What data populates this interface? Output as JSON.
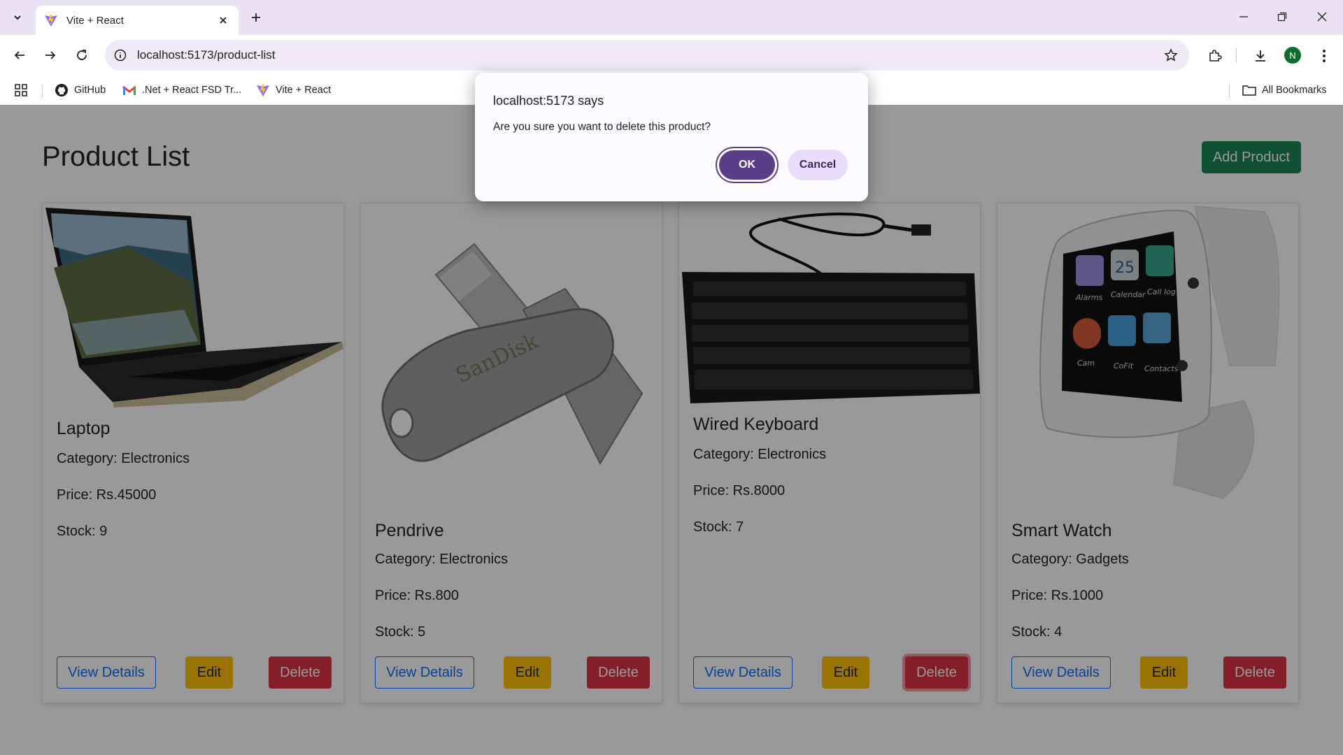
{
  "browser": {
    "tab_title": "Vite + React",
    "url": "localhost:5173/product-list",
    "avatar_letter": "N",
    "bookmarks": [
      {
        "label": "GitHub",
        "icon": "github-icon"
      },
      {
        "label": ".Net + React FSD Tr...",
        "icon": "gmail-icon"
      },
      {
        "label": "Vite + React",
        "icon": "vite-icon"
      }
    ],
    "all_bookmarks": "All Bookmarks"
  },
  "page": {
    "title": "Product List",
    "add_button": "Add Product"
  },
  "products": [
    {
      "name": "Laptop",
      "category": "Category: Electronics",
      "price": "Price: Rs.45000",
      "stock": "Stock: 9",
      "image": "laptop-image"
    },
    {
      "name": "Pendrive",
      "category": "Category: Electronics",
      "price": "Price: Rs.800",
      "stock": "Stock: 5",
      "image": "pendrive-image"
    },
    {
      "name": "Wired Keyboard",
      "category": "Category: Electronics",
      "price": "Price: Rs.8000",
      "stock": "Stock: 7",
      "image": "keyboard-image"
    },
    {
      "name": "Smart Watch",
      "category": "Category: Gadgets",
      "price": "Price: Rs.1000",
      "stock": "Stock: 4",
      "image": "smartwatch-image"
    }
  ],
  "card_buttons": {
    "view": "View Details",
    "edit": "Edit",
    "delete": "Delete"
  },
  "dialog": {
    "title": "localhost:5173 says",
    "message": "Are you sure you want to delete this product?",
    "ok": "OK",
    "cancel": "Cancel"
  },
  "colors": {
    "primary": "#0d6efd",
    "success": "#198754",
    "warning": "#ffc107",
    "danger": "#dc3545",
    "dialog_accent": "#5b3e8a"
  }
}
